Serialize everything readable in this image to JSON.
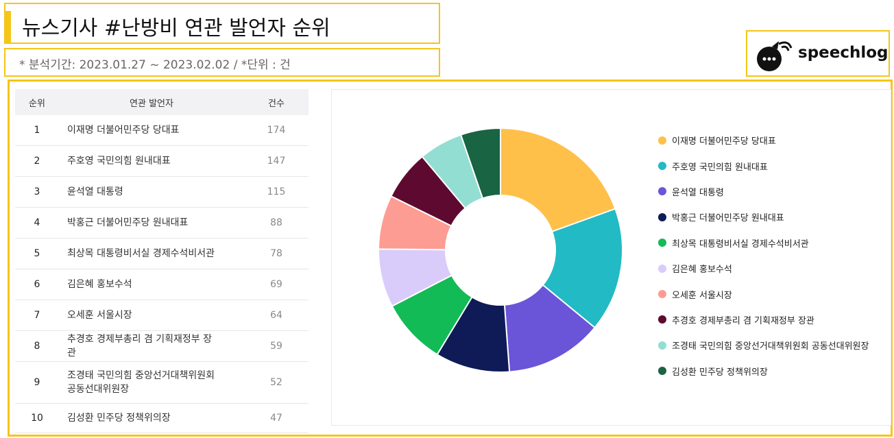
{
  "header": {
    "title": "뉴스기사 #난방비 연관 발언자 순위",
    "subtitle": "* 분석기간: 2023.01.27 ~ 2023.02.02 / *단위 : 건"
  },
  "logo": {
    "text": "speechlog",
    "icon": "speech-bubble-icon"
  },
  "table": {
    "headers": {
      "rank": "순위",
      "name": "연관 발언자",
      "count": "건수"
    },
    "rows": [
      {
        "rank": "1",
        "name": "이재명 더불어민주당 당대표",
        "count": "174"
      },
      {
        "rank": "2",
        "name": "주호영 국민의힘 원내대표",
        "count": "147"
      },
      {
        "rank": "3",
        "name": "윤석열 대통령",
        "count": "115"
      },
      {
        "rank": "4",
        "name": "박홍근 더불어민주당 원내대표",
        "count": "88"
      },
      {
        "rank": "5",
        "name": "최상목 대통령비서실 경제수석비서관",
        "count": "78"
      },
      {
        "rank": "6",
        "name": "김은혜 홍보수석",
        "count": "69"
      },
      {
        "rank": "7",
        "name": "오세훈 서울시장",
        "count": "64"
      },
      {
        "rank": "8",
        "name": "추경호 경제부총리 겸 기획재정부 장관",
        "count": "59"
      },
      {
        "rank": "9",
        "name": "조경태 국민의힘 중앙선거대책위원회 공동선대위원장",
        "count": "52"
      },
      {
        "rank": "10",
        "name": "김성환 민주당 정책위의장",
        "count": "47"
      }
    ]
  },
  "chart_data": {
    "type": "pie",
    "donut": true,
    "legend_position": "right",
    "categories": [
      "이재명 더불어민주당 당대표",
      "주호영 국민의힘 원내대표",
      "윤석열 대통령",
      "박홍근 더불어민주당 원내대표",
      "최상목 대통령비서실 경제수석비서관",
      "김은혜 홍보수석",
      "오세훈 서울시장",
      "추경호 경제부총리 겸 기획재정부 장관",
      "조경태 국민의힘 중앙선거대책위원회 공동선대위원장",
      "김성환 민주당 정책위의장"
    ],
    "values": [
      174,
      147,
      115,
      88,
      78,
      69,
      64,
      59,
      52,
      47
    ],
    "colors": [
      "#ffc04a",
      "#22bac4",
      "#6a54d8",
      "#0e1b57",
      "#12bb56",
      "#d9ccfa",
      "#fd9c92",
      "#5e0a30",
      "#93ded3",
      "#186443"
    ]
  },
  "theme": {
    "accent": "#f5c518"
  }
}
